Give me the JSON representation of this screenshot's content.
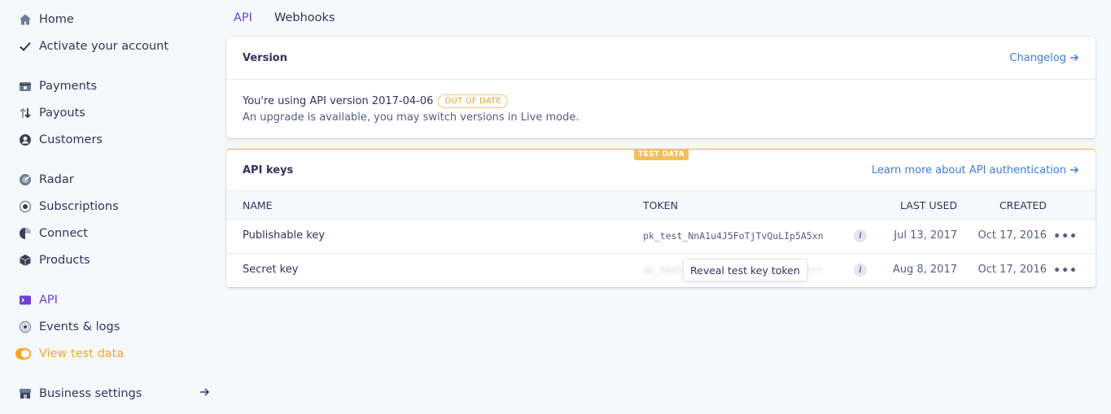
{
  "sidebar": {
    "home": "Home",
    "activate": "Activate your account",
    "payments": "Payments",
    "payouts": "Payouts",
    "customers": "Customers",
    "radar": "Radar",
    "subscriptions": "Subscriptions",
    "connect": "Connect",
    "products": "Products",
    "api": "API",
    "events": "Events & logs",
    "view_test_data": "View test data",
    "business_settings": "Business settings"
  },
  "tabs": {
    "api": "API",
    "webhooks": "Webhooks"
  },
  "version_card": {
    "title": "Version",
    "changelog_link": "Changelog",
    "message": "You're using API version 2017-04-06",
    "badge": "OUT OF DATE",
    "subtext": "An upgrade is available, you may switch versions in Live mode."
  },
  "keys_card": {
    "test_badge": "TEST DATA",
    "title": "API keys",
    "learn_more_link": "Learn more about API authentication",
    "columns": {
      "name": "NAME",
      "token": "TOKEN",
      "last_used": "LAST USED",
      "created": "CREATED"
    },
    "rows": [
      {
        "name": "Publishable key",
        "token": "pk_test_NnA1u4J5FoTjTvQuLIp5A5xn",
        "last_used": "Jul 13, 2017",
        "created": "Oct 17, 2016"
      },
      {
        "name": "Secret key",
        "token": "sk_test_••••••••••••••••••••••••",
        "reveal_label": "Reveal test key token",
        "last_used": "Aug 8, 2017",
        "created": "Oct 17, 2016"
      }
    ],
    "info_glyph": "i",
    "more_glyph": "•••"
  },
  "colors": {
    "accent": "#6b3fd4",
    "link": "#3d7bd8",
    "test_orange": "#f5a623",
    "text": "#32325d",
    "background": "#f6f9fc"
  }
}
